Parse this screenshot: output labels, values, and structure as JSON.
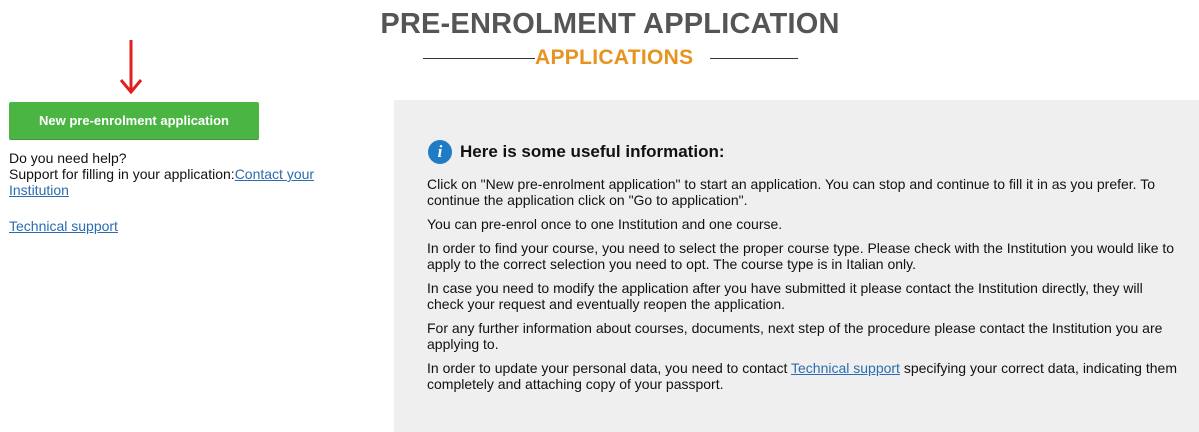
{
  "header": {
    "title": "PRE-ENROLMENT APPLICATION",
    "subtitle": "APPLICATIONS"
  },
  "colors": {
    "accent_orange": "#e69320",
    "button_green": "#4bb543",
    "arrow_red": "#e02020",
    "link_blue": "#2b6cb0",
    "info_blue": "#1e7bc6",
    "panel_bg": "#efefef"
  },
  "sidebar": {
    "new_application_button": "New pre-enrolment application",
    "help_question": "Do you need help?",
    "support_text": "Support for filling in your application:",
    "contact_link": "Contact your Institution",
    "technical_support_link": "Technical support"
  },
  "info": {
    "icon": "info-icon",
    "icon_glyph": "i",
    "title": "Here is some useful information:",
    "paragraphs": [
      "Click on \"New pre-enrolment application\" to start an application. You can stop and continue to fill it in as you prefer. To continue the application click on \"Go to application\".",
      "You can pre-enrol once to one Institution and one course.",
      "In order to find your course, you need to select the proper course type. Please check with the Institution you would like to apply to the correct selection you need to opt. The course type is in Italian only.",
      "In case you need to modify the application after you have submitted it please contact the Institution directly, they will check your request and eventually reopen the application.",
      "For any further information about courses, documents, next step of the procedure please contact the Institution you are applying to."
    ],
    "last_paragraph_before": "In order to update your personal data, you need to contact ",
    "last_paragraph_link": "Technical support",
    "last_paragraph_after": " specifying your correct data, indicating them completely and attaching copy of your passport."
  }
}
